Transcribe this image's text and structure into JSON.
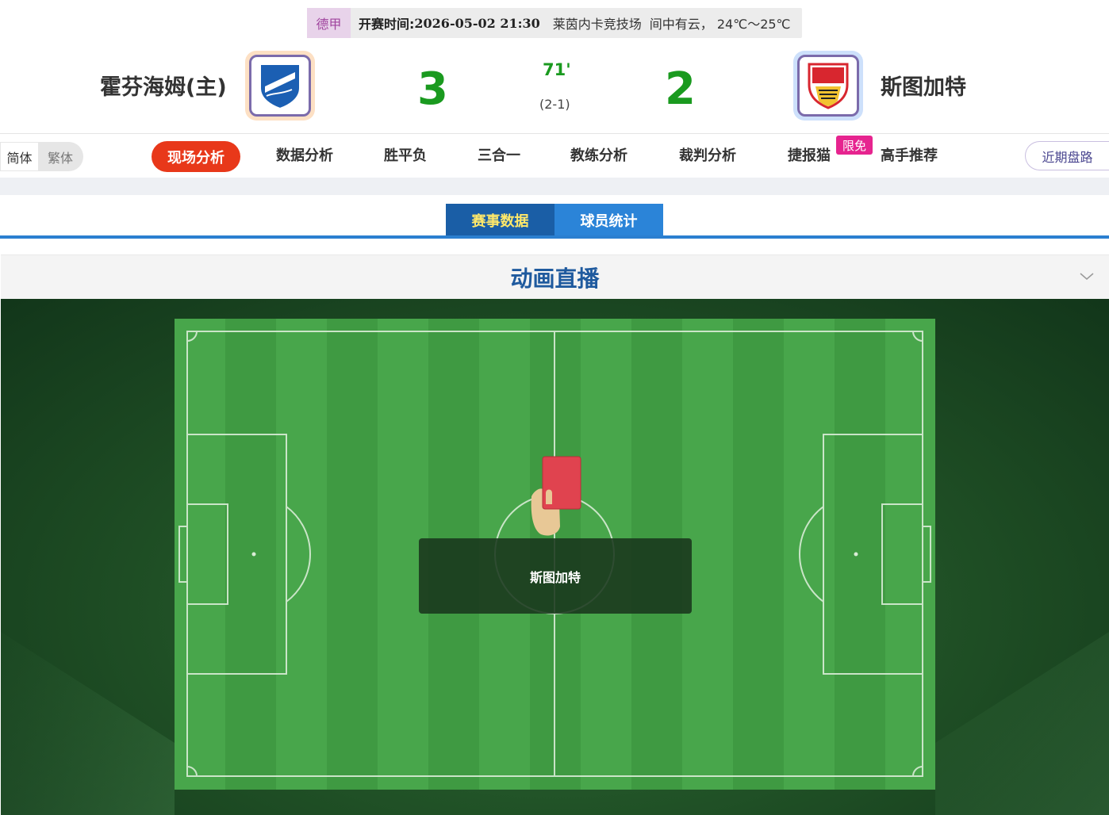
{
  "match": {
    "league": "德甲",
    "kickoff_label": "开赛时间:",
    "kickoff_time": "2026-05-02 21:30",
    "venue": "莱茵内卡竞技场",
    "weather": "间中有云， 24℃～25℃"
  },
  "home": {
    "name": "霍芬海姆(主)",
    "score": "3",
    "logo_icon": "hoffenheim-crest-icon"
  },
  "away": {
    "name": "斯图加特",
    "score": "2",
    "logo_icon": "stuttgart-crest-icon"
  },
  "status": {
    "minute": "71'",
    "halftime": "(2-1)"
  },
  "lang": {
    "simplified": "简体",
    "traditional": "繁体"
  },
  "nav": {
    "items": [
      "现场分析",
      "数据分析",
      "胜平负",
      "三合一",
      "教练分析",
      "裁判分析",
      "捷报猫",
      "高手推荐"
    ],
    "active_index": 0,
    "free_badge": "限免",
    "recent": "近期盘路"
  },
  "sub_tabs": [
    "赛事数据",
    "球员统计"
  ],
  "live": {
    "title": "动画直播",
    "event_team": "斯图加特",
    "event_icon": "red-card-icon"
  },
  "colors": {
    "score_green": "#1a9a1f",
    "nav_active": "#e8381a",
    "tab_active": "#1a5ea6",
    "tab_inactive": "#2b84d8",
    "live_title": "#1f5a9e",
    "red_card": "#e0434f",
    "free_badge": "#e6248f"
  }
}
